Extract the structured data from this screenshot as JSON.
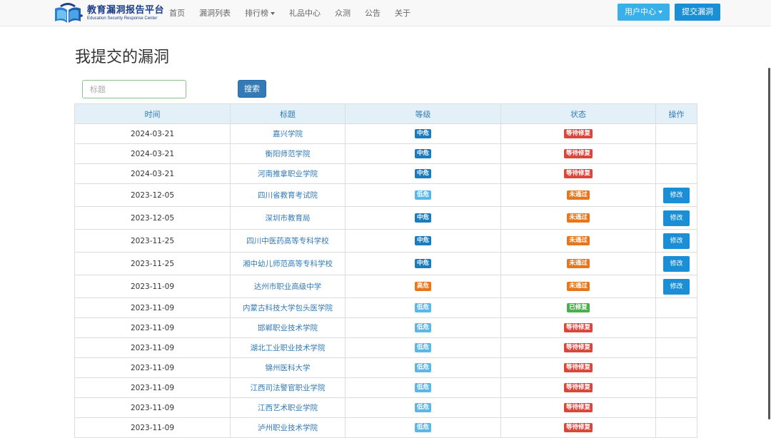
{
  "colors": {
    "level_medium": "#1a7bbf",
    "level_low": "#5bb8e6",
    "level_high": "#e8751a",
    "status_pending": "#d9463a",
    "status_rejected": "#e8751a",
    "status_fixed": "#4cae4c"
  },
  "header": {
    "brand_title": "教育漏洞报告平台",
    "brand_subtitle": "Education Security Response Center",
    "nav_items": [
      {
        "label": "首页",
        "dropdown": false
      },
      {
        "label": "漏洞列表",
        "dropdown": false
      },
      {
        "label": "排行榜",
        "dropdown": true
      },
      {
        "label": "礼品中心",
        "dropdown": false
      },
      {
        "label": "众测",
        "dropdown": false
      },
      {
        "label": "公告",
        "dropdown": false
      },
      {
        "label": "关于",
        "dropdown": false
      }
    ],
    "user_center_label": "用户中心",
    "submit_label": "提交漏洞"
  },
  "page": {
    "title": "我提交的漏洞",
    "search_placeholder": "标题",
    "search_button": "搜索"
  },
  "table": {
    "columns": [
      "时间",
      "标题",
      "等级",
      "状态",
      "操作"
    ],
    "edit_label": "修改",
    "rows": [
      {
        "date": "2024-03-21",
        "title": "嘉兴学院",
        "level": "中危",
        "level_color": "#1a7bbf",
        "status": "等待修复",
        "status_color": "#d9463a",
        "editable": false
      },
      {
        "date": "2024-03-21",
        "title": "衡阳师范学院",
        "level": "中危",
        "level_color": "#1a7bbf",
        "status": "等待修复",
        "status_color": "#d9463a",
        "editable": false
      },
      {
        "date": "2024-03-21",
        "title": "河南推拿职业学院",
        "level": "中危",
        "level_color": "#1a7bbf",
        "status": "等待修复",
        "status_color": "#d9463a",
        "editable": false
      },
      {
        "date": "2023-12-05",
        "title": "四川省教育考试院",
        "level": "低危",
        "level_color": "#5bb8e6",
        "status": "未通过",
        "status_color": "#e8751a",
        "editable": true
      },
      {
        "date": "2023-12-05",
        "title": "深圳市教育局",
        "level": "中危",
        "level_color": "#1a7bbf",
        "status": "未通过",
        "status_color": "#e8751a",
        "editable": true
      },
      {
        "date": "2023-11-25",
        "title": "四川中医药高等专科学校",
        "level": "中危",
        "level_color": "#1a7bbf",
        "status": "未通过",
        "status_color": "#e8751a",
        "editable": true
      },
      {
        "date": "2023-11-25",
        "title": "湘中幼儿师范高等专科学校",
        "level": "中危",
        "level_color": "#1a7bbf",
        "status": "未通过",
        "status_color": "#e8751a",
        "editable": true
      },
      {
        "date": "2023-11-09",
        "title": "达州市职业高级中学",
        "level": "高危",
        "level_color": "#e8751a",
        "status": "未通过",
        "status_color": "#e8751a",
        "editable": true
      },
      {
        "date": "2023-11-09",
        "title": "内蒙古科技大学包头医学院",
        "level": "低危",
        "level_color": "#5bb8e6",
        "status": "已修复",
        "status_color": "#4cae4c",
        "editable": false
      },
      {
        "date": "2023-11-09",
        "title": "邯郸职业技术学院",
        "level": "低危",
        "level_color": "#5bb8e6",
        "status": "等待修复",
        "status_color": "#d9463a",
        "editable": false
      },
      {
        "date": "2023-11-09",
        "title": "湖北工业职业技术学院",
        "level": "低危",
        "level_color": "#5bb8e6",
        "status": "等待修复",
        "status_color": "#d9463a",
        "editable": false
      },
      {
        "date": "2023-11-09",
        "title": "锦州医科大学",
        "level": "低危",
        "level_color": "#5bb8e6",
        "status": "等待修复",
        "status_color": "#d9463a",
        "editable": false
      },
      {
        "date": "2023-11-09",
        "title": "江西司法警官职业学院",
        "level": "低危",
        "level_color": "#5bb8e6",
        "status": "等待修复",
        "status_color": "#d9463a",
        "editable": false
      },
      {
        "date": "2023-11-09",
        "title": "江西艺术职业学院",
        "level": "低危",
        "level_color": "#5bb8e6",
        "status": "等待修复",
        "status_color": "#d9463a",
        "editable": false
      },
      {
        "date": "2023-11-09",
        "title": "泸州职业技术学院",
        "level": "低危",
        "level_color": "#5bb8e6",
        "status": "等待修复",
        "status_color": "#d9463a",
        "editable": false
      }
    ]
  }
}
